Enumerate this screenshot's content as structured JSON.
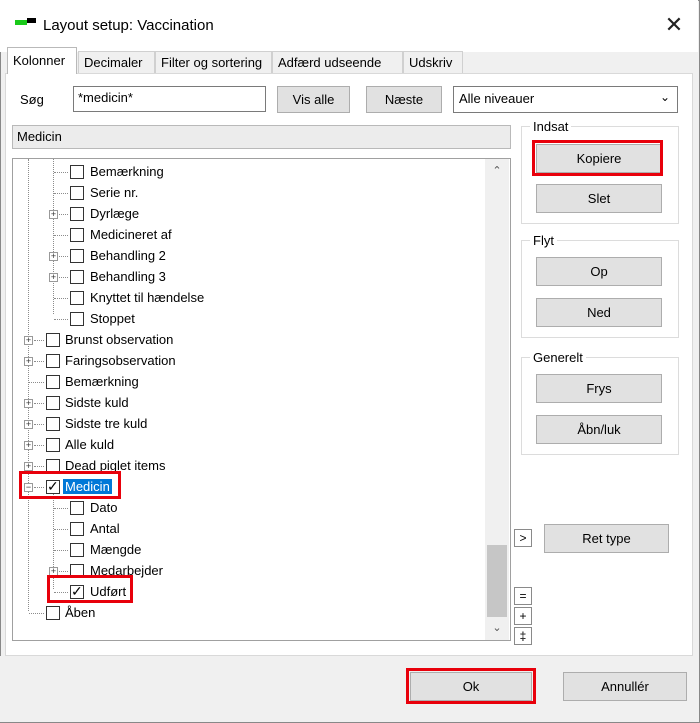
{
  "window": {
    "title": "Layout setup: Vaccination",
    "close_symbol": "✕"
  },
  "tabs": [
    {
      "label": "Kolonner",
      "active": true
    },
    {
      "label": "Decimaler",
      "active": false
    },
    {
      "label": "Filter og sortering",
      "active": false
    },
    {
      "label": "Adfærd  udseende",
      "active": false
    },
    {
      "label": "Udskriv",
      "active": false
    }
  ],
  "search": {
    "label": "Søg",
    "value": "*medicin*",
    "show_all": "Vis alle",
    "next": "Næste",
    "level_select": "Alle niveauer"
  },
  "tree_header": "Medicin",
  "tree": [
    {
      "label": "Bemærkning",
      "checked": false,
      "expandable": false
    },
    {
      "label": "Serie nr.",
      "checked": false,
      "expandable": false
    },
    {
      "label": "Dyrlæge",
      "checked": false,
      "expandable": true
    },
    {
      "label": "Medicineret af",
      "checked": false,
      "expandable": false
    },
    {
      "label": "Behandling 2",
      "checked": false,
      "expandable": true
    },
    {
      "label": "Behandling 3",
      "checked": false,
      "expandable": true
    },
    {
      "label": "Knyttet til hændelse",
      "checked": false,
      "expandable": false
    },
    {
      "label": "Stoppet",
      "checked": false,
      "expandable": false
    },
    {
      "label": "Brunst observation",
      "checked": false,
      "expandable": true
    },
    {
      "label": "Faringsobservation",
      "checked": false,
      "expandable": true
    },
    {
      "label": "Bemærkning",
      "checked": false,
      "expandable": false
    },
    {
      "label": "Sidste kuld",
      "checked": false,
      "expandable": true
    },
    {
      "label": "Sidste tre kuld",
      "checked": false,
      "expandable": true
    },
    {
      "label": "Alle kuld",
      "checked": false,
      "expandable": true
    },
    {
      "label": "Dead piglet items",
      "checked": false,
      "expandable": true
    },
    {
      "label": "Medicin",
      "checked": true,
      "expandable": true,
      "expanded": true,
      "selected": true
    },
    {
      "label": "Dato",
      "checked": false,
      "expandable": false
    },
    {
      "label": "Antal",
      "checked": false,
      "expandable": false
    },
    {
      "label": "Mængde",
      "checked": false,
      "expandable": false
    },
    {
      "label": "Medarbejder",
      "checked": false,
      "expandable": true
    },
    {
      "label": "Udført",
      "checked": true,
      "expandable": false
    },
    {
      "label": "Åben",
      "checked": false,
      "expandable": false
    }
  ],
  "groups": {
    "indsat": {
      "title": "Indsat",
      "copy": "Kopiere",
      "delete": "Slet"
    },
    "flyt": {
      "title": "Flyt",
      "up": "Op",
      "down": "Ned"
    },
    "generelt": {
      "title": "Generelt",
      "freeze": "Frys",
      "open_close": "Åbn/luk"
    }
  },
  "ret_type": "Ret type",
  "side_buttons": {
    "arrow": ">",
    "equal": "=",
    "plus": "+",
    "plusplus": "‡"
  },
  "footer": {
    "ok": "Ok",
    "cancel": "Annullér"
  },
  "colors": {
    "highlight": "#e8000b",
    "selection": "#0078d7"
  }
}
